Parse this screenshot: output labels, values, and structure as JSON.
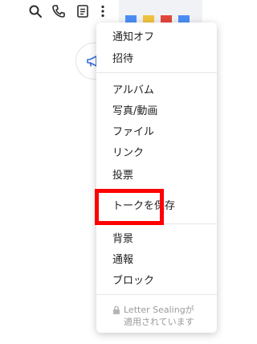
{
  "menu": {
    "items": [
      {
        "label": "通知オフ"
      },
      {
        "label": "招待"
      },
      {
        "label": "アルバム"
      },
      {
        "label": "写真/動画"
      },
      {
        "label": "ファイル"
      },
      {
        "label": "リンク"
      },
      {
        "label": "投票"
      },
      {
        "label": "トークを保存"
      },
      {
        "label": "背景"
      },
      {
        "label": "通報"
      },
      {
        "label": "ブロック"
      }
    ],
    "footer": {
      "line1": "Letter Sealingが",
      "line2": "適用されています"
    }
  },
  "colors": {
    "highlight": "#ff0000",
    "icon": "#2b2b2b",
    "footer_text": "#9a9a9a",
    "accent_blue": "#3b6fd8"
  },
  "icons": [
    "search-icon",
    "call-icon",
    "notes-icon",
    "more-vertical-icon",
    "megaphone-icon",
    "lock-icon"
  ]
}
